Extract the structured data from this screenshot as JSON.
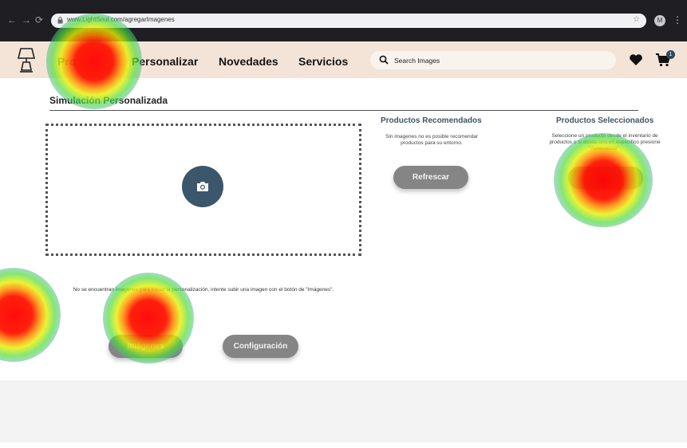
{
  "browser": {
    "back_icon": "←",
    "forward_icon": "→",
    "reload_icon": "⟳",
    "url": "www.LightSoul.com/agregarImagenes",
    "star_icon": "☆",
    "profile_initial": "M",
    "menu_icon": "⋮"
  },
  "header": {
    "nav": [
      "Pro",
      "Personalizar",
      "Novedades",
      "Servicios"
    ],
    "search_placeholder": "Search Images",
    "cart_count": "1"
  },
  "main": {
    "title": "Simulación Personalizada",
    "recommended": {
      "title": "Productos Recomendados",
      "text": "Sin imagenes no es posible recomendar productos para su entorno.",
      "refresh_label": "Refrescar"
    },
    "selected": {
      "title": "Productos Seleccionados",
      "text": "Seleccione un producto desde el inventario de productos o si desea uno en especifico presione \"Seleccionar\"."
    },
    "info_text": "No se encuentran imagenes para iniciar la personalización, intente subir una imagen con el botón de \"Imágenes\".",
    "images_label": "Imágenes",
    "config_label": "Configuración"
  },
  "colors": {
    "header_bg": "#f4e4d8",
    "accent": "#3c566c",
    "button_gray": "#858585"
  }
}
